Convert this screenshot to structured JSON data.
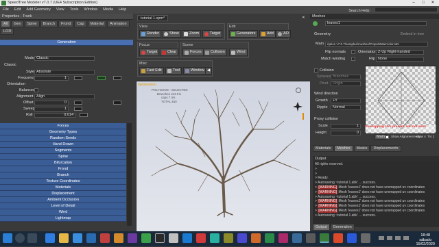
{
  "window": {
    "title": "SpeedTree Modeler v7.0.7 (UE4 Subscription Edition)"
  },
  "menu": [
    "File",
    "Edit",
    "Add Geometry",
    "View",
    "Tools",
    "Window",
    "Media",
    "Help"
  ],
  "search": {
    "label": "Search Help:"
  },
  "left": {
    "title": "Properties - Trunk",
    "tabs": [
      "All",
      "Gen",
      "Spine",
      "Branch",
      "Frond",
      "Cap",
      "Material",
      "Animation",
      "LOD"
    ],
    "generation_header": "Generation",
    "mode_label": "Mode",
    "mode_value": "Classic",
    "classic_label": "Classic",
    "style_label": "Style",
    "style_value": "Absolute",
    "frequency_label": "Frequency",
    "frequency_value": "1",
    "orientation_label": "Orientation",
    "balanced_label": "Balanced",
    "alignment_label": "Alignment",
    "alignment_value": "Align",
    "offset_label": "Offset",
    "offset_value": "0",
    "sweep_label": "Sweep",
    "sweep_value": "1",
    "roll_label": "Roll",
    "roll_value": "0.014",
    "sections": [
      "Forces",
      "Geometry Types",
      "Random Seeds",
      "Hand Drawn",
      "Segments",
      "Spine",
      "Bifurcation",
      "Frond",
      "Branch",
      "Texture Coordinates",
      "Materials",
      "Displacement",
      "Ambient Occlusion",
      "Level of Detail",
      "Wind",
      "Lightmap"
    ]
  },
  "center": {
    "doc_tab": "tutorial 1.spm*",
    "view_label": "View",
    "edit_label": "Edit",
    "focus_label": "Focus",
    "scene_label": "Scene",
    "misc_label": "Misc",
    "view_buttons": [
      "Render",
      "Show",
      "Zoom",
      "Target"
    ],
    "edit_buttons": [
      "Generators",
      "Add",
      "AO"
    ],
    "focus_buttons": [
      "Target",
      "Clear"
    ],
    "scene_buttons": [
      "Forces",
      "Collision",
      "Wind"
    ],
    "misc_buttons": [
      "Fast Edit",
      "Tool",
      "Window"
    ],
    "viewport_label": "Generation",
    "stats": [
      "POLYGONS - SELECTED",
      "Branches 443 tris",
      "caps 7 tris",
      "TOTAL 450"
    ],
    "status": "28 tps(s), 8 Pixels(s), Last Compute: 392.16 ms (draw to draw 33.33 ms)"
  },
  "right": {
    "meshes_title": "Meshes",
    "mesh_name": "leaves1",
    "geometry_label": "Geometry",
    "embed_label": "Embed in tree",
    "main_label": "Main",
    "main_path": "ription v7.0.7/samples/meshes/Props/Watercolor.stm",
    "flip_normals": "Flip normals",
    "orientation_label": "Orientation",
    "orientation_value": "Z-Up Right-handed",
    "match_winding": "Match winding",
    "flip_label": "Flip",
    "flip_value": "None",
    "collision_label": "Collision",
    "spheres_label": "Spheres",
    "spheres_value": "Branches",
    "pivot_label": "Pivot",
    "pivot_value": "Origin",
    "wind_dir_label": "Wind direction",
    "growth_label": "Growth",
    "growth_value": "+Y",
    "ripple_label": "Ripple",
    "ripple_value": "Normal",
    "proxy_label": "Proxy collision",
    "scale_label": "Scale",
    "scale_value": "1",
    "height_label": "Height",
    "height_value": "0",
    "main_btn": "Main",
    "show_align": "Show Alignment Help",
    "lods": [
      "Icons 4",
      "Trs 2"
    ],
    "warning_overlay": "Overlapping UVs present, will not work",
    "tabs": [
      "Materials",
      "Meshes",
      "Masks",
      "Displacements"
    ],
    "output_title": "Output",
    "output_lines": [
      {
        "t": "All rights reserved.",
        "w": ""
      },
      {
        "t": ">",
        "w": ""
      },
      {
        "t": ">",
        "w": ""
      },
      {
        "t": "> Ready.",
        "w": ""
      },
      {
        "t": "> Autosaving ~tutorial 1.abk' ... success.",
        "w": ""
      },
      {
        "t": " Mesh 'leaves1' does not have unwrapped uv coordinates",
        "w": "[WARNING]"
      },
      {
        "t": " Mesh 'leaves1' does not have unwrapped uv coordinates",
        "w": "[WARNING]"
      },
      {
        "t": "> Autosaving ~tutorial 1.abk' ... success.",
        "w": ""
      },
      {
        "t": " Mesh 'leaves1' does not have unwrapped uv coordinates",
        "w": "[WARNING]"
      },
      {
        "t": " Mesh 'leaves1' does not have unwrapped uv coordinates",
        "w": "[WARNING]"
      },
      {
        "t": " Mesh 'leaves1' does not have unwrapped uv coordinates",
        "w": "[WARNING]"
      },
      {
        "t": "> Autosaving ~tutorial 1.abk' ... success.",
        "w": ""
      }
    ],
    "bottom_tabs": [
      "Output",
      "Generation"
    ]
  },
  "taskbar": {
    "time": "18:48",
    "day": "sábado",
    "date": "15/02/2020"
  }
}
